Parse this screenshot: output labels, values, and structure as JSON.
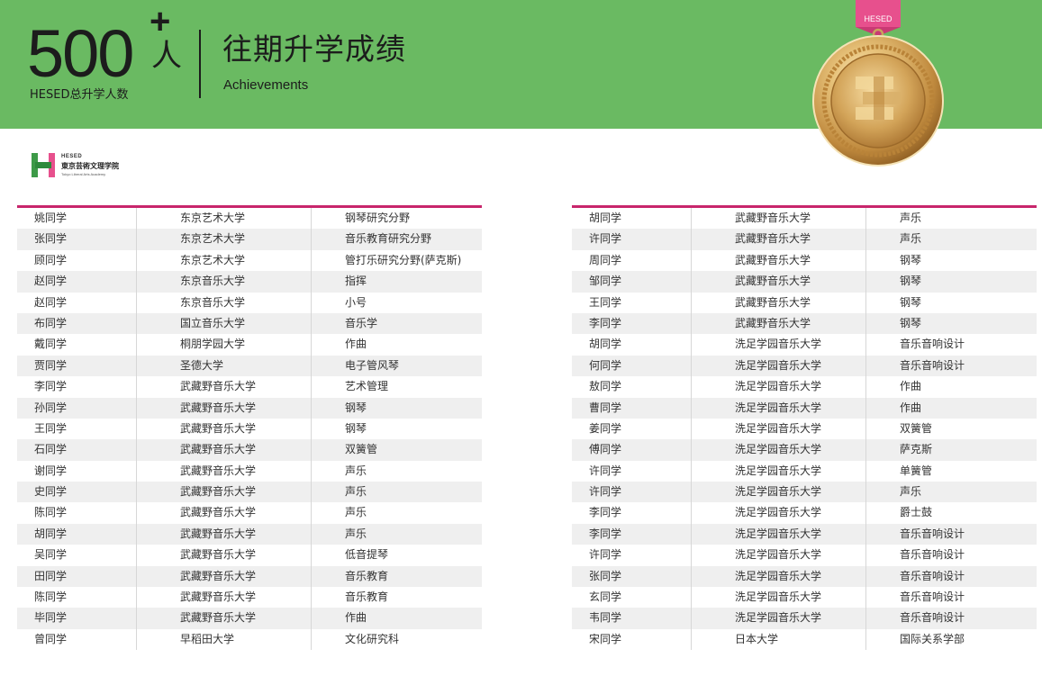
{
  "header": {
    "count": "500",
    "plus": "+",
    "unit": "人",
    "count_label": "HESED总升学人数",
    "title": "往期升学成绩",
    "subtitle": "Achievements",
    "banner_color": "#6aba62"
  },
  "medal": {
    "ribbon_text": "HESED",
    "icon": "gold-medal-icon"
  },
  "logo": {
    "brand": "HESED",
    "name_cn": "東京芸術文理学院",
    "name_en": "Tokyo Liberal Arts Academy"
  },
  "accent_color": "#c8266c",
  "left_table": [
    {
      "name": "姚同学",
      "school": "东京艺术大学",
      "major": "钢琴研究分野"
    },
    {
      "name": "张同学",
      "school": "东京艺术大学",
      "major": "音乐教育研究分野"
    },
    {
      "name": "顾同学",
      "school": "东京艺术大学",
      "major": "管打乐研究分野(萨克斯)"
    },
    {
      "name": "赵同学",
      "school": "东京音乐大学",
      "major": "指挥"
    },
    {
      "name": "赵同学",
      "school": "东京音乐大学",
      "major": "小号"
    },
    {
      "name": "布同学",
      "school": "国立音乐大学",
      "major": "音乐学"
    },
    {
      "name": "戴同学",
      "school": "桐朋学园大学",
      "major": "作曲"
    },
    {
      "name": "贾同学",
      "school": "圣德大学",
      "major": "电子管风琴"
    },
    {
      "name": "李同学",
      "school": "武藏野音乐大学",
      "major": "艺术管理"
    },
    {
      "name": "孙同学",
      "school": "武藏野音乐大学",
      "major": "钢琴"
    },
    {
      "name": "王同学",
      "school": "武藏野音乐大学",
      "major": "钢琴"
    },
    {
      "name": "石同学",
      "school": "武藏野音乐大学",
      "major": "双簧管"
    },
    {
      "name": "谢同学",
      "school": "武藏野音乐大学",
      "major": "声乐"
    },
    {
      "name": "史同学",
      "school": "武藏野音乐大学",
      "major": "声乐"
    },
    {
      "name": "陈同学",
      "school": "武藏野音乐大学",
      "major": "声乐"
    },
    {
      "name": "胡同学",
      "school": "武藏野音乐大学",
      "major": "声乐"
    },
    {
      "name": "吴同学",
      "school": "武藏野音乐大学",
      "major": "低音提琴"
    },
    {
      "name": "田同学",
      "school": "武藏野音乐大学",
      "major": "音乐教育"
    },
    {
      "name": "陈同学",
      "school": "武藏野音乐大学",
      "major": "音乐教育"
    },
    {
      "name": "毕同学",
      "school": "武藏野音乐大学",
      "major": "作曲"
    },
    {
      "name": "曾同学",
      "school": "早稻田大学",
      "major": "文化研究科"
    }
  ],
  "right_table": [
    {
      "name": "胡同学",
      "school": "武藏野音乐大学",
      "major": "声乐"
    },
    {
      "name": "许同学",
      "school": "武藏野音乐大学",
      "major": "声乐"
    },
    {
      "name": "周同学",
      "school": "武藏野音乐大学",
      "major": "钢琴"
    },
    {
      "name": "邹同学",
      "school": "武藏野音乐大学",
      "major": "钢琴"
    },
    {
      "name": "王同学",
      "school": "武藏野音乐大学",
      "major": "钢琴"
    },
    {
      "name": "李同学",
      "school": "武藏野音乐大学",
      "major": "钢琴"
    },
    {
      "name": "胡同学",
      "school": "洗足学园音乐大学",
      "major": "音乐音响设计"
    },
    {
      "name": "何同学",
      "school": "洗足学园音乐大学",
      "major": "音乐音响设计"
    },
    {
      "name": "敖同学",
      "school": "洗足学园音乐大学",
      "major": "作曲"
    },
    {
      "name": "曹同学",
      "school": "洗足学园音乐大学",
      "major": "作曲"
    },
    {
      "name": "姜同学",
      "school": "洗足学园音乐大学",
      "major": "双簧管"
    },
    {
      "name": "傅同学",
      "school": "洗足学园音乐大学",
      "major": "萨克斯"
    },
    {
      "name": "许同学",
      "school": "洗足学园音乐大学",
      "major": "单簧管"
    },
    {
      "name": "许同学",
      "school": "洗足学园音乐大学",
      "major": "声乐"
    },
    {
      "name": "李同学",
      "school": "洗足学园音乐大学",
      "major": "爵士鼓"
    },
    {
      "name": "李同学",
      "school": "洗足学园音乐大学",
      "major": "音乐音响设计"
    },
    {
      "name": "许同学",
      "school": "洗足学园音乐大学",
      "major": "音乐音响设计"
    },
    {
      "name": "张同学",
      "school": "洗足学园音乐大学",
      "major": "音乐音响设计"
    },
    {
      "name": "玄同学",
      "school": "洗足学园音乐大学",
      "major": "音乐音响设计"
    },
    {
      "name": "韦同学",
      "school": "洗足学园音乐大学",
      "major": "音乐音响设计"
    },
    {
      "name": "宋同学",
      "school": "日本大学",
      "major": "国际关系学部"
    }
  ]
}
